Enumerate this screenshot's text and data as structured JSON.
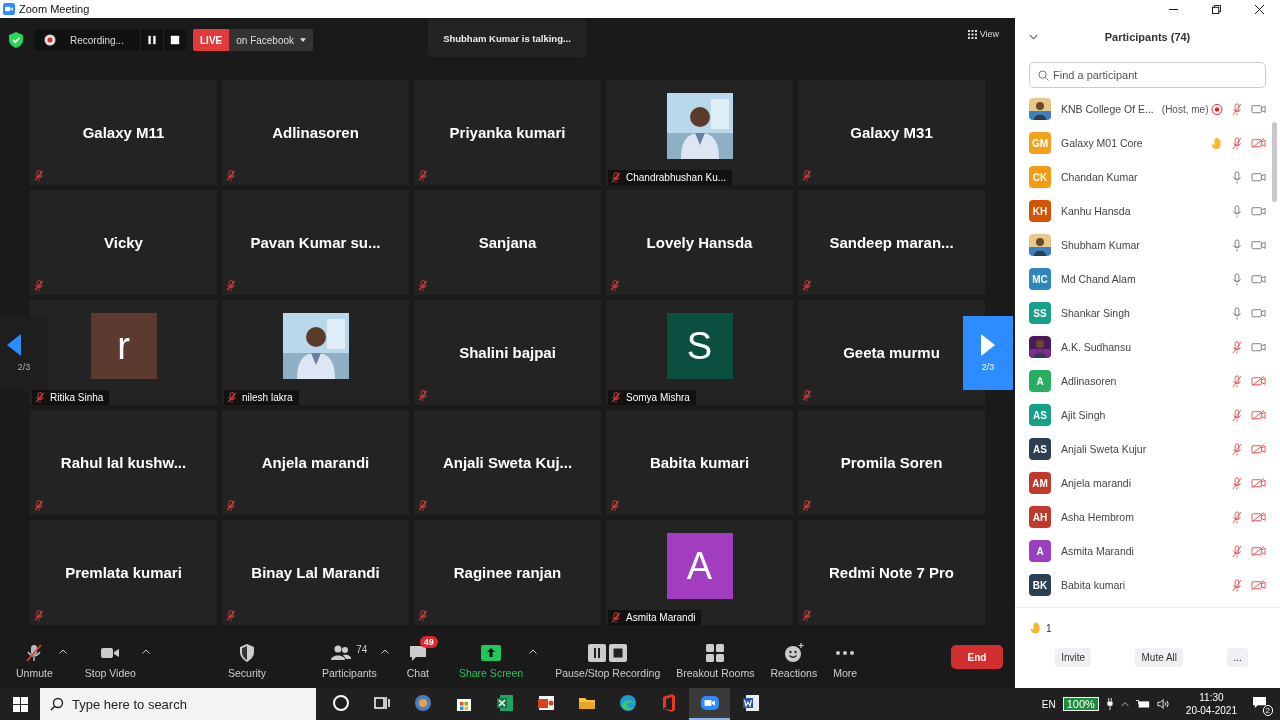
{
  "window": {
    "title": "Zoom Meeting"
  },
  "topbar": {
    "recording_label": "Recording...",
    "live_label": "LIVE",
    "live_target": "on Facebook",
    "talking": "Shubham Kumar is talking...",
    "view_button": "View"
  },
  "gallery": {
    "prev_page": "2/3",
    "next_page": "2/3",
    "tiles": [
      {
        "kind": "name",
        "name": "Galaxy M11"
      },
      {
        "kind": "name",
        "name": "Adlinasoren"
      },
      {
        "kind": "name",
        "name": "Priyanka kumari"
      },
      {
        "name": "Chandrabhushan Ku..."
      },
      {
        "kind": "name",
        "name": "Galaxy M31"
      },
      {
        "kind": "name",
        "name": "Vicky"
      },
      {
        "kind": "name",
        "name": "Pavan Kumar su..."
      },
      {
        "kind": "name",
        "name": "Sanjana"
      },
      {
        "kind": "name",
        "name": "Lovely Hansda"
      },
      {
        "kind": "name",
        "name": "Sandeep maran..."
      },
      {
        "kind": "letter",
        "name": "Ritika Sinha",
        "letter": "r",
        "color": "#5c3a30"
      },
      {
        "name": "nilesh lakra"
      },
      {
        "kind": "name",
        "name": "Shalini bajpai"
      },
      {
        "kind": "letter",
        "name": "Somya Mishra",
        "letter": "S",
        "color": "#0b4f40"
      },
      {
        "kind": "name",
        "name": "Geeta murmu"
      },
      {
        "kind": "name",
        "name": "Rahul lal kushw..."
      },
      {
        "kind": "name",
        "name": "Anjela marandi"
      },
      {
        "kind": "name",
        "name": "Anjali Sweta Kuj..."
      },
      {
        "kind": "name",
        "name": "Babita kumari"
      },
      {
        "kind": "name",
        "name": "Promila Soren"
      },
      {
        "kind": "name",
        "name": "Premlata kumari"
      },
      {
        "kind": "name",
        "name": "Binay Lal Marandi"
      },
      {
        "kind": "name",
        "name": "Raginee ranjan"
      },
      {
        "kind": "letter",
        "name": "Asmita Marandi",
        "letter": "A",
        "color": "#a33dbf"
      },
      {
        "kind": "name",
        "name": "Redmi Note 7 Pro"
      }
    ]
  },
  "toolbar": {
    "items": [
      {
        "kind": "mic",
        "label": "Unmute",
        "caret": true,
        "accent": false
      },
      {
        "kind": "camera",
        "label": "Stop Video",
        "caret": true,
        "accent": false
      },
      {
        "kind": "shield",
        "label": "Security",
        "caret": false,
        "accent": false
      },
      {
        "kind": "people",
        "label": "Participants",
        "count": "74",
        "caret": true,
        "accent": false
      },
      {
        "kind": "chat",
        "label": "Chat",
        "badge": "49",
        "caret": false,
        "accent": false
      },
      {
        "kind": "share",
        "label": "Share Screen",
        "caret": true,
        "accent": true
      },
      {
        "kind": "record",
        "label": "Pause/Stop Recording",
        "caret": false,
        "accent": false
      },
      {
        "kind": "grid",
        "label": "Breakout Rooms",
        "caret": false,
        "accent": false
      },
      {
        "kind": "emoji",
        "label": "Reactions",
        "caret": false,
        "accent": false
      },
      {
        "kind": "dots",
        "label": "More",
        "caret": false,
        "accent": false
      }
    ],
    "end_button": "End"
  },
  "participants_panel": {
    "title": "Participants (74)",
    "search": {
      "placeholder": "Find a participant"
    },
    "participants": [
      {
        "name": "KNB College Of E...",
        "role": "(Host, me)",
        "kind": "picture",
        "recording": true,
        "hand_raised": false,
        "muted": true,
        "video_on": true
      },
      {
        "name": "Galaxy M01 Core",
        "kind": "initials",
        "initials": "GM",
        "color": "#f2a21a",
        "recording": false,
        "hand_raised": true,
        "muted": true,
        "video_on": false
      },
      {
        "name": "Chandan Kumar",
        "kind": "initials",
        "initials": "CK",
        "color": "#f39c12",
        "recording": false,
        "hand_raised": false,
        "muted": false,
        "video_on": true
      },
      {
        "name": "Kanhu Hansda",
        "kind": "initials",
        "initials": "KH",
        "color": "#d35400",
        "recording": false,
        "hand_raised": false,
        "muted": false,
        "video_on": true
      },
      {
        "name": "Shubham Kumar",
        "kind": "picture",
        "recording": false,
        "hand_raised": false,
        "muted": false,
        "video_on": true
      },
      {
        "name": "Md Chand Alam",
        "kind": "initials",
        "initials": "MC",
        "color": "#2e86c1",
        "recording": false,
        "hand_raised": false,
        "muted": false,
        "video_on": true
      },
      {
        "name": "Shankar Singh",
        "kind": "initials",
        "initials": "SS",
        "color": "#16a085",
        "recording": false,
        "hand_raised": false,
        "muted": false,
        "video_on": true
      },
      {
        "name": "A.K. Sudhansu",
        "kind": "picture",
        "recording": false,
        "hand_raised": false,
        "muted": true,
        "video_on": true
      },
      {
        "name": "Adlinasoren",
        "kind": "initials",
        "initials": "A",
        "color": "#27ae60",
        "recording": false,
        "hand_raised": false,
        "muted": true,
        "video_on": false
      },
      {
        "name": "Ajit Singh",
        "kind": "initials",
        "initials": "AS",
        "color": "#16a085",
        "recording": false,
        "hand_raised": false,
        "muted": true,
        "video_on": false
      },
      {
        "name": "Anjali Sweta Kujur",
        "kind": "initials",
        "initials": "AS",
        "color": "#2c3e50",
        "recording": false,
        "hand_raised": false,
        "muted": true,
        "video_on": false
      },
      {
        "name": "Anjela marandi",
        "kind": "initials",
        "initials": "AM",
        "color": "#c0392b",
        "recording": false,
        "hand_raised": false,
        "muted": true,
        "video_on": false
      },
      {
        "name": "Asha Hembrom",
        "kind": "initials",
        "initials": "AH",
        "color": "#c0392b",
        "recording": false,
        "hand_raised": false,
        "muted": true,
        "video_on": false
      },
      {
        "name": "Asmita Marandi",
        "kind": "initials",
        "initials": "A",
        "color": "#9b3fc2",
        "recording": false,
        "hand_raised": false,
        "muted": true,
        "video_on": false
      },
      {
        "name": "Babita kumari",
        "kind": "initials",
        "initials": "BK",
        "color": "#2c3e50",
        "recording": false,
        "hand_raised": false,
        "muted": true,
        "video_on": false
      }
    ],
    "raised_hands": "1",
    "buttons": [
      "Invite",
      "Mute All",
      "..."
    ]
  },
  "taskbar": {
    "search": {
      "placeholder": "Type here to search"
    },
    "apps": [
      {
        "kind": "cortana",
        "selected": false
      },
      {
        "kind": "taskview",
        "selected": false
      },
      {
        "kind": "media",
        "selected": false
      },
      {
        "kind": "store",
        "selected": false
      },
      {
        "kind": "excel",
        "selected": false
      },
      {
        "kind": "slides",
        "selected": false
      },
      {
        "kind": "folder",
        "selected": false
      },
      {
        "kind": "edge",
        "selected": false
      },
      {
        "kind": "office",
        "selected": false
      },
      {
        "kind": "zoom",
        "selected": true
      },
      {
        "kind": "word",
        "selected": false
      }
    ],
    "language": "EN",
    "battery": "100%",
    "time": "11:30",
    "date": "20-04-2021",
    "notifications": "2"
  }
}
